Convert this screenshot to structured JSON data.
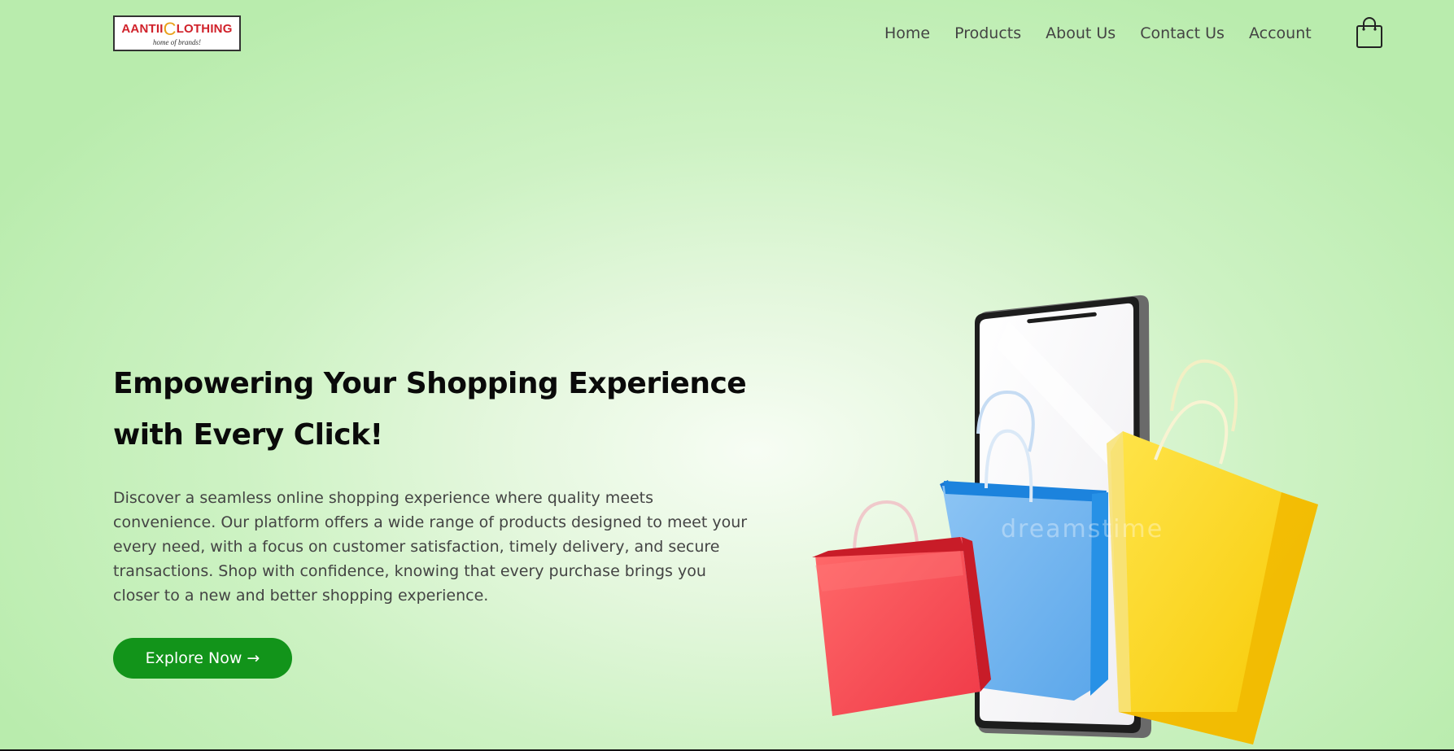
{
  "header": {
    "logo": {
      "brand_left": "AANTII",
      "brand_c": "C",
      "brand_right": "LOTHING",
      "tagline": "home of brands!"
    },
    "nav": [
      "Home",
      "Products",
      "About Us",
      "Contact Us",
      "Account"
    ],
    "cart_icon": "shopping-bag-icon"
  },
  "hero": {
    "title_line1": "Empowering Your Shopping Experience",
    "title_line2": "with Every Click!",
    "description": "Discover a seamless online shopping experience where quality meets convenience. Our platform offers a wide range of products designed to meet your every need, with a focus on customer satisfaction, timely delivery, and secure transactions. Shop with confidence, knowing that every purchase brings you closer to a new and better shopping experience.",
    "cta_label": "Explore Now →"
  },
  "colors": {
    "accent": "#12941a",
    "background": "#cdf2c3",
    "logo_red": "#d0212a"
  }
}
